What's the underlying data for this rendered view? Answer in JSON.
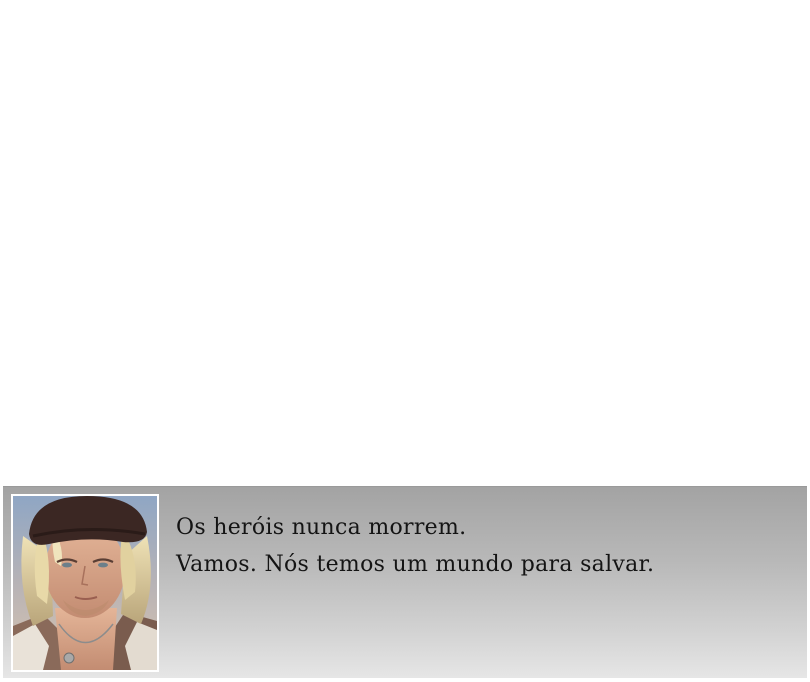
{
  "dialog": {
    "portrait_icon": "character-portrait-snow",
    "lines": [
      "Os heróis nunca morrem.",
      "Vamos. Nós temos um mundo para salvar."
    ]
  },
  "colors": {
    "dialog_top": "#a3a3a3",
    "dialog_bottom": "#e6e6e6",
    "text": "#141414",
    "portrait_border": "#ffffff"
  }
}
